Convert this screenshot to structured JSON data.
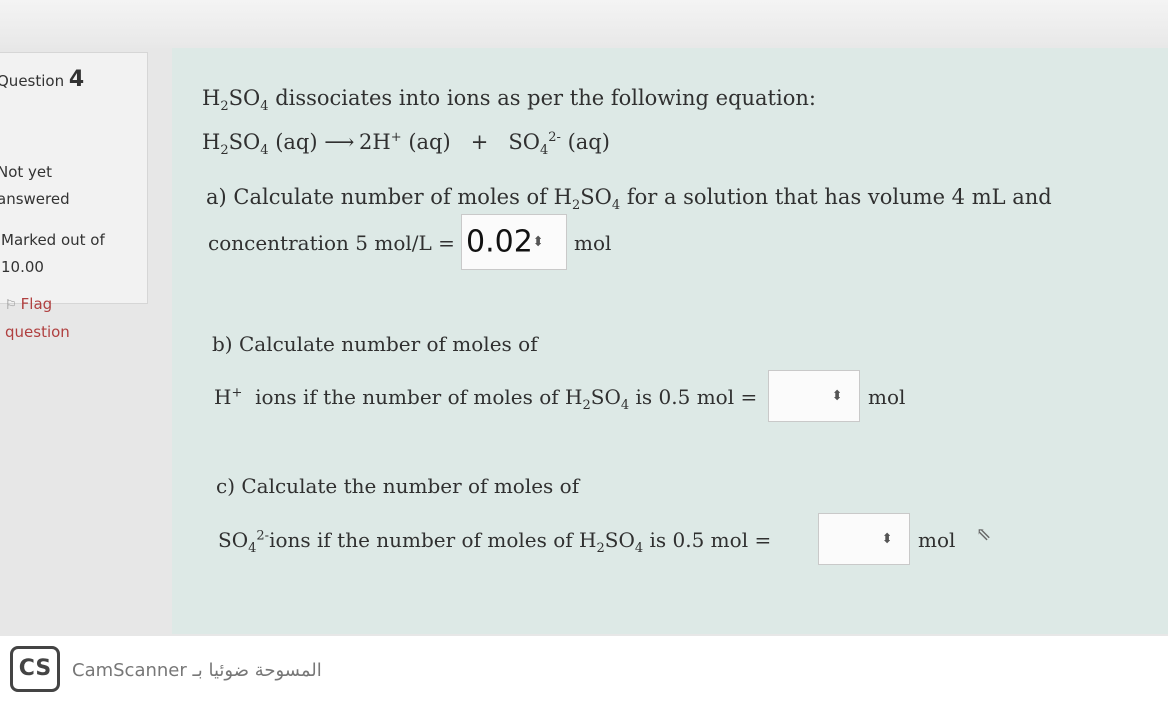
{
  "question_info": {
    "question_label": "Question",
    "question_number": "4",
    "state_line1": "Not yet",
    "state_line2": "answered",
    "marked_line1": "Marked out of",
    "marked_line2": "10.00",
    "flag_line1": "Flag",
    "flag_line2": "question"
  },
  "question": {
    "intro": "dissociates into ions as per the following equation:",
    "equation": {
      "reactant_state": "(aq)",
      "product1": "2H",
      "product1_state": "(aq)",
      "plus": "+",
      "product2_state": "(aq)"
    },
    "part_a": {
      "line1_pre": "a) Calculate number of moles of",
      "line1_post": "for a solution that has volume 4 mL and",
      "line2": "concentration 5 mol/L =",
      "value": "0.02",
      "unit": "mol"
    },
    "part_b": {
      "line1": "b) Calculate number of  moles of",
      "line2_pre": "ions if the number of moles of",
      "line2_post": "is 0.5 mol =",
      "value": "",
      "unit": "mol"
    },
    "part_c": {
      "line1": "c) Calculate the number of moles of",
      "line2_pre": "ions  if the number of moles of",
      "line2_post": "is 0.5 mol  =",
      "value": "",
      "unit": "mol"
    }
  },
  "watermark": {
    "logo": "CS",
    "text": "CamScanner المسوحة ضوئيا بـ"
  }
}
